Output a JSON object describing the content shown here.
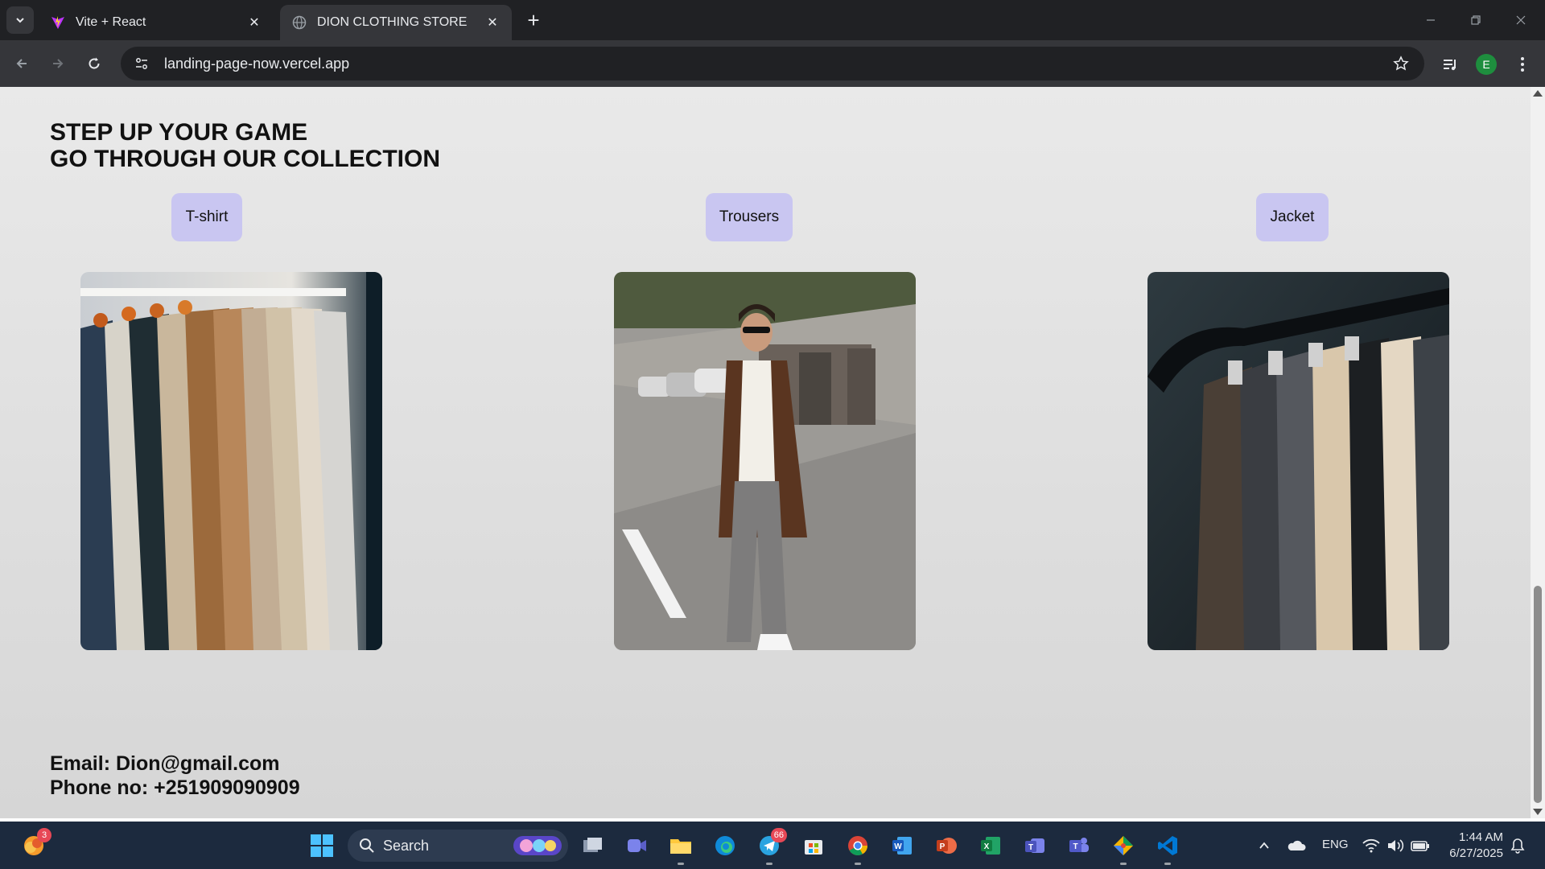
{
  "browser": {
    "tabs": [
      {
        "title": "Vite + React",
        "active": false
      },
      {
        "title": "DION CLOTHING STORE",
        "active": true
      }
    ],
    "url": "landing-page-now.vercel.app",
    "profile_initial": "E"
  },
  "page": {
    "heading_line1": "STEP UP YOUR GAME",
    "heading_line2": "GO THROUGH OUR COLLECTION",
    "categories": [
      {
        "label": "T-shirt",
        "image": "shirts-on-hangers-photo"
      },
      {
        "label": "Trousers",
        "image": "man-walking-in-coat-photo"
      },
      {
        "label": "Jacket",
        "image": "jackets-on-rack-photo"
      }
    ],
    "contact": {
      "email": "Email: Dion@gmail.com",
      "phone": "Phone no: +251909090909"
    },
    "colors": {
      "category_button": "#c9c6f1",
      "background": "#e2e2e2"
    }
  },
  "taskbar": {
    "search_label": "Search",
    "copilot_badge": "3",
    "telegram_badge": "66",
    "language": "ENG",
    "time": "1:44 AM",
    "date": "6/27/2025"
  }
}
